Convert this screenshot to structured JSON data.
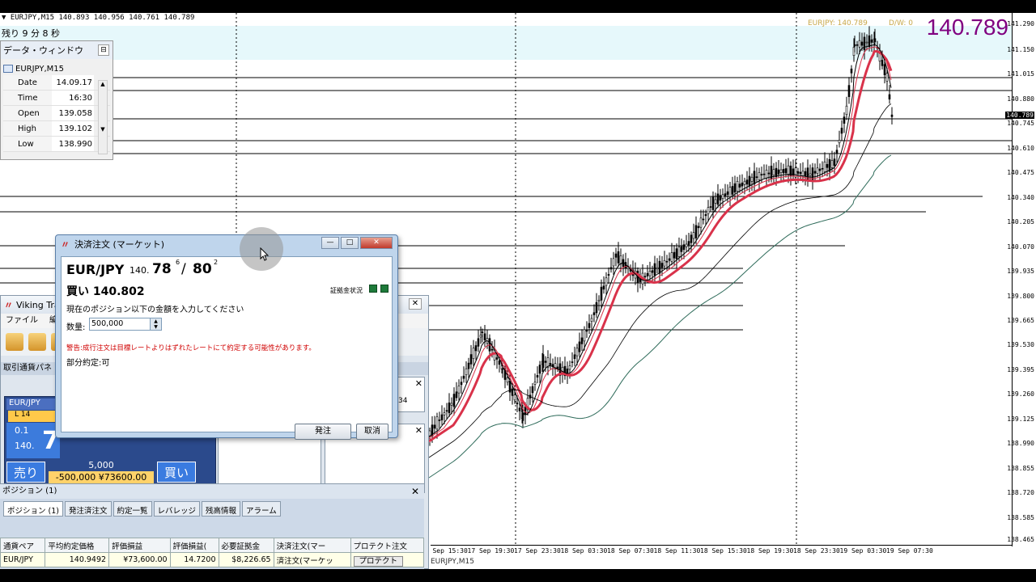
{
  "chart": {
    "title_line": "▼ EURJPY,M15  140.893 140.956 140.761 140.789",
    "remaining_time": "残り 9 分 8 秒",
    "big_price": "140.789",
    "indicator_label_1": "EURJPY: 140.789",
    "indicator_label_2": "D/W: 0",
    "price_ticks": [
      "141.290",
      "141.150",
      "141.015",
      "140.880",
      "140.789",
      "140.745",
      "140.610",
      "140.475",
      "140.340",
      "140.205",
      "140.070",
      "139.935",
      "139.800",
      "139.665",
      "139.530",
      "139.395",
      "139.260",
      "139.125",
      "138.990",
      "138.855",
      "138.720",
      "138.585",
      "138.465"
    ],
    "current_price_tick": "140.789",
    "time_ticks": [
      "17 Sep 15:30",
      "17 Sep 19:30",
      "17 Sep 23:30",
      "18 Sep 03:30",
      "18 Sep 07:30",
      "18 Sep 11:30",
      "18 Sep 15:30",
      "18 Sep 19:30",
      "18 Sep 23:30",
      "19 Sep 03:30",
      "19 Sep 07:30"
    ],
    "symbol_tab": "EURJPY,M15",
    "colors": {
      "ma_red": "#d9324a",
      "ma_dark": "#2e6b5a",
      "candle": "#000000",
      "highlight_band": "#e6f8fb",
      "big_price": "#800080"
    }
  },
  "data_window": {
    "title": "データ・ウィンドウ",
    "close_label": "⊟",
    "symbol": "EURJPY,M15",
    "rows": [
      {
        "label": "Date",
        "value": "14.09.17"
      },
      {
        "label": "Time",
        "value": "16:30"
      },
      {
        "label": "Open",
        "value": "139.058"
      },
      {
        "label": "High",
        "value": "139.102"
      },
      {
        "label": "Low",
        "value": "138.990"
      }
    ]
  },
  "viking": {
    "title": "Viking Tra",
    "menu": [
      "ファイル",
      "編集"
    ],
    "panel_header": "取引通貨パネ",
    "rate_panel": {
      "pair": "EUR/JPY",
      "l_label": "L 14",
      "lot": "0.1",
      "prefix": "140.",
      "big_digit": "7",
      "sell": "売り",
      "buy": "買い",
      "spread_qty": "5,000",
      "pl": "-500,000  ¥73600.00"
    },
    "side_value": "34"
  },
  "positions": {
    "title": "ポジション (1)",
    "tabs": [
      "ポジション (1)",
      "発注済注文",
      "約定一覧",
      "レバレッジ",
      "残高情報",
      "アラーム"
    ],
    "columns": [
      "通貨ペア",
      "平均約定価格",
      "評価損益",
      "評価損益(",
      "必要証拠金",
      "決済注文(マー",
      "プロテクト注文"
    ],
    "rows": [
      {
        "pair": "EUR/JPY",
        "avg_price": "140.9492",
        "pl": "¥73,600.00",
        "pl_pips": "14.7200",
        "margin": "$8,226.65",
        "close_order": "済注文(マーケッ",
        "protect": "プロテクト"
      }
    ]
  },
  "order_dialog": {
    "title": "決済注文 (マーケット)",
    "pair": "EUR/JPY",
    "quote_prefix": "140.",
    "bid_main": "78",
    "bid_sup": "6",
    "separator": "/",
    "ask_main": "80",
    "ask_sup": "2",
    "side_label": "買い  140.802",
    "status_label": "証拠金状況",
    "instruction": "現在のポジション以下の金額を入力してください",
    "qty_label": "数量:",
    "qty_value": "500,000",
    "warning": "警告:成行注文は目標レートよりはずれたレートにて約定する可能性があります。",
    "partial": "部分約定:可",
    "order_button": "発注",
    "cancel_button": "取消",
    "ctrl_min": "—",
    "ctrl_max": "□",
    "ctrl_close": "✕"
  }
}
